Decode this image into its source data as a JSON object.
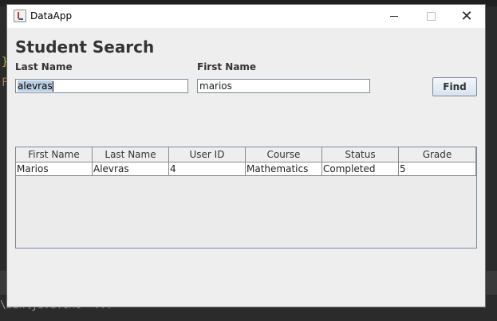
{
  "window": {
    "title": "DataApp"
  },
  "titlebar_icons": {
    "minimize": "minimize-icon",
    "maximize": "maximize-icon",
    "close": "close-icon"
  },
  "background": {
    "console_text": "\\bin\\java.exe  ...",
    "gutter_mark_1": "}",
    "gutter_mark_2": "F"
  },
  "form": {
    "heading": "Student Search",
    "last_name_label": "Last Name",
    "first_name_label": "First Name",
    "last_name_value": "alevras",
    "first_name_value": "marios",
    "find_label": "Find"
  },
  "table": {
    "columns": [
      "First Name",
      "Last Name",
      "User ID",
      "Course",
      "Status",
      "Grade"
    ],
    "rows": [
      [
        "Marios",
        "Alevras",
        "4",
        "Mathematics",
        "Completed",
        "5"
      ]
    ]
  },
  "colors": {
    "selection": "#b8cfe5",
    "window_bg": "#eeeeee",
    "ide_bg": "#2b2b2b"
  }
}
